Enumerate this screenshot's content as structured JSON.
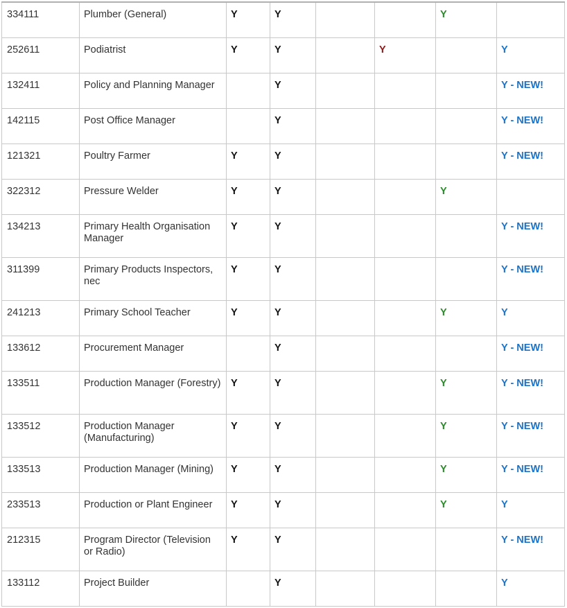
{
  "table": {
    "rows": [
      {
        "code": "334111",
        "name": "Plumber (General)",
        "a": "Y",
        "b": "Y",
        "c": "",
        "d": "",
        "e": "Y",
        "f": "",
        "h": 1
      },
      {
        "code": "252611",
        "name": "Podiatrist",
        "a": "Y",
        "b": "Y",
        "c": "",
        "d": "Y",
        "e": "",
        "f": "Y",
        "h": 1
      },
      {
        "code": "132411",
        "name": "Policy and Planning Manager",
        "a": "",
        "b": "Y",
        "c": "",
        "d": "",
        "e": "",
        "f": "Y - NEW!",
        "h": 1
      },
      {
        "code": "142115",
        "name": "Post Office Manager",
        "a": "",
        "b": "Y",
        "c": "",
        "d": "",
        "e": "",
        "f": "Y - NEW!",
        "h": 1
      },
      {
        "code": "121321",
        "name": "Poultry Farmer",
        "a": "Y",
        "b": "Y",
        "c": "",
        "d": "",
        "e": "",
        "f": "Y - NEW!",
        "h": 1
      },
      {
        "code": "322312",
        "name": "Pressure Welder",
        "a": "Y",
        "b": "Y",
        "c": "",
        "d": "",
        "e": "Y",
        "f": "",
        "h": 1
      },
      {
        "code": "134213",
        "name": "Primary Health Organisation Manager",
        "a": "Y",
        "b": "Y",
        "c": "",
        "d": "",
        "e": "",
        "f": "Y - NEW!",
        "h": 2
      },
      {
        "code": "311399",
        "name": "Primary Products Inspectors, nec",
        "a": "Y",
        "b": "Y",
        "c": "",
        "d": "",
        "e": "",
        "f": "Y - NEW!",
        "h": 2
      },
      {
        "code": "241213",
        "name": "Primary School Teacher",
        "a": "Y",
        "b": "Y",
        "c": "",
        "d": "",
        "e": "Y",
        "f": "Y",
        "h": 1
      },
      {
        "code": "133612",
        "name": "Procurement Manager",
        "a": "",
        "b": "Y",
        "c": "",
        "d": "",
        "e": "",
        "f": "Y - NEW!",
        "h": 1
      },
      {
        "code": "133511",
        "name": "Production Manager (Forestry)",
        "a": "Y",
        "b": "Y",
        "c": "",
        "d": "",
        "e": "Y",
        "f": "Y - NEW!",
        "h": 2
      },
      {
        "code": "133512",
        "name": "Production Manager (Manufacturing)",
        "a": "Y",
        "b": "Y",
        "c": "",
        "d": "",
        "e": "Y",
        "f": "Y - NEW!",
        "h": 2
      },
      {
        "code": "133513",
        "name": "Production Manager (Mining)",
        "a": "Y",
        "b": "Y",
        "c": "",
        "d": "",
        "e": "Y",
        "f": "Y - NEW!",
        "h": 1
      },
      {
        "code": "233513",
        "name": "Production or Plant Engineer",
        "a": "Y",
        "b": "Y",
        "c": "",
        "d": "",
        "e": "Y",
        "f": "Y",
        "h": 1
      },
      {
        "code": "212315",
        "name": "Program Director (Television or Radio)",
        "a": "Y",
        "b": "Y",
        "c": "",
        "d": "",
        "e": "",
        "f": "Y - NEW!",
        "h": 2
      },
      {
        "code": "133112",
        "name": "Project Builder",
        "a": "",
        "b": "Y",
        "c": "",
        "d": "",
        "e": "",
        "f": "Y",
        "h": 1
      }
    ]
  },
  "colors": {
    "col_a": "#111111",
    "col_b": "#111111",
    "col_c": "#111111",
    "col_d": "#8b1a1a",
    "col_e": "#2a8a2a",
    "col_f": "#1a73c9",
    "grid": "#c8c8c8",
    "text": "#333333"
  }
}
